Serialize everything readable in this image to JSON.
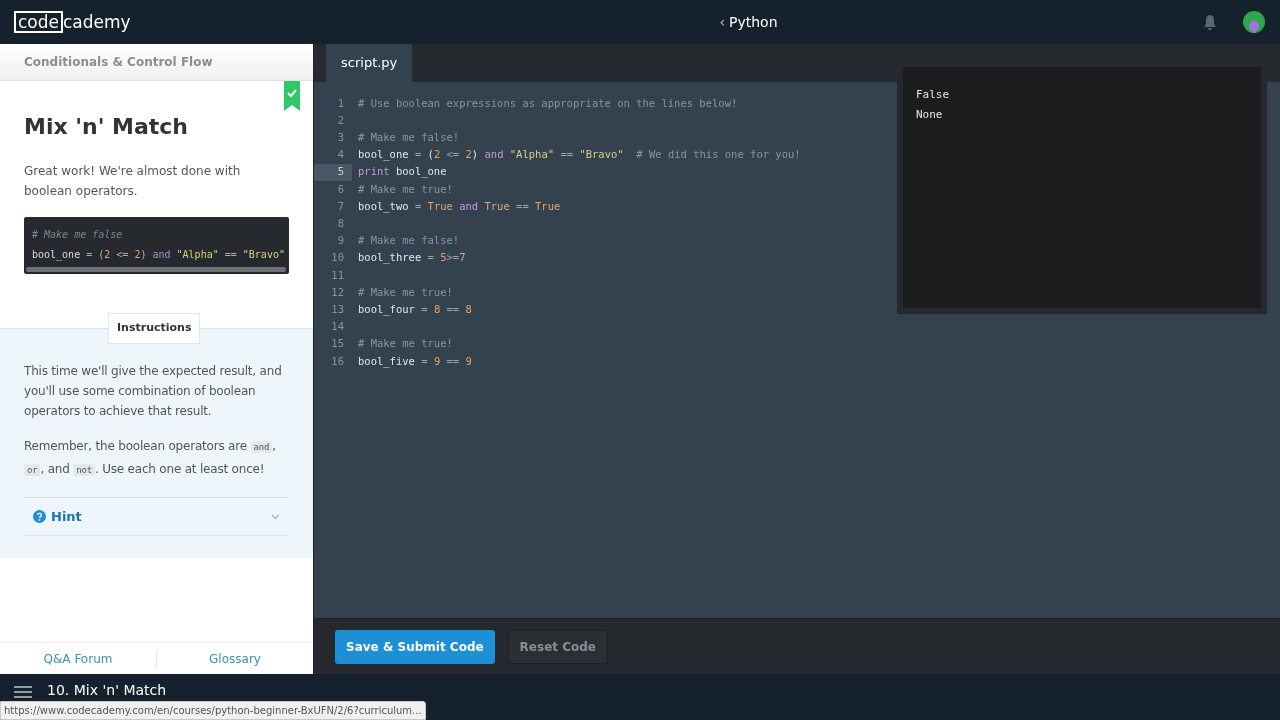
{
  "header": {
    "logo_boxed": "code",
    "logo_rest": "cademy",
    "back": "‹",
    "course": "Python"
  },
  "lesson": {
    "unit": "Conditionals & Control Flow",
    "completed": true,
    "title": "Mix 'n' Match",
    "intro": "Great work! We're almost done with boolean operators.",
    "snippet": [
      [
        {
          "kind": "comment",
          "text": "# Make me false"
        }
      ],
      [
        {
          "kind": "name",
          "text": "bool_one "
        },
        {
          "kind": "op",
          "text": "= ("
        },
        {
          "kind": "num",
          "text": "2"
        },
        {
          "kind": "op",
          "text": " <= "
        },
        {
          "kind": "num",
          "text": "2"
        },
        {
          "kind": "op",
          "text": ") "
        },
        {
          "kind": "kw",
          "text": "and "
        },
        {
          "kind": "str",
          "text": "\"Alpha\""
        },
        {
          "kind": "op",
          "text": " == "
        },
        {
          "kind": "str",
          "text": "\"Bravo\""
        }
      ]
    ],
    "instructions_label": "Instructions",
    "paragraph": "This time we'll give the expected result, and you'll use some combination of boolean operators to achieve that result.",
    "remember": [
      {
        "kind": "text",
        "text": "Remember, the boolean operators are "
      },
      {
        "kind": "code",
        "text": "and"
      },
      {
        "kind": "text",
        "text": ", "
      },
      {
        "kind": "code",
        "text": "or"
      },
      {
        "kind": "text",
        "text": ", and "
      },
      {
        "kind": "code",
        "text": "not"
      },
      {
        "kind": "text",
        "text": ". Use each one at least once!"
      }
    ],
    "hint": {
      "label": "Hint",
      "expanded": false
    },
    "footer": [
      "Q&A Forum",
      "Glossary"
    ]
  },
  "editor": {
    "tab": "script.py",
    "lines": [
      {
        "number": "1",
        "active": false,
        "tokens": [
          {
            "kind": "comment",
            "text": "# Use boolean expressions as appropriate on the lines below!"
          }
        ]
      },
      {
        "number": "2",
        "active": false
      },
      {
        "number": "3",
        "active": false,
        "tokens": [
          {
            "kind": "comment",
            "text": "# Make me false!"
          }
        ]
      },
      {
        "number": "4",
        "active": false,
        "tokens": [
          {
            "kind": "name",
            "text": "bool_one "
          },
          {
            "kind": "op",
            "text": "= "
          },
          {
            "kind": "name",
            "text": "("
          },
          {
            "kind": "num",
            "text": "2"
          },
          {
            "kind": "op",
            "text": " <= "
          },
          {
            "kind": "num",
            "text": "2"
          },
          {
            "kind": "name",
            "text": ") "
          },
          {
            "kind": "kw",
            "text": "and "
          },
          {
            "kind": "str",
            "text": "\"Alpha\""
          },
          {
            "kind": "op",
            "text": " == "
          },
          {
            "kind": "str",
            "text": "\"Bravo\""
          },
          {
            "kind": "comment",
            "text": "  # We did this one for you!"
          }
        ]
      },
      {
        "number": "5",
        "active": true,
        "tokens": [
          {
            "kind": "kw",
            "text": "print "
          },
          {
            "kind": "name",
            "text": "bool_one"
          }
        ]
      },
      {
        "number": "6",
        "active": false,
        "tokens": [
          {
            "kind": "comment",
            "text": "# Make me true!"
          }
        ]
      },
      {
        "number": "7",
        "active": false,
        "tokens": [
          {
            "kind": "name",
            "text": "bool_two "
          },
          {
            "kind": "op",
            "text": "= "
          },
          {
            "kind": "num",
            "text": "True "
          },
          {
            "kind": "kw",
            "text": "and "
          },
          {
            "kind": "num",
            "text": "True "
          },
          {
            "kind": "op",
            "text": "== "
          },
          {
            "kind": "num",
            "text": "True"
          }
        ]
      },
      {
        "number": "8",
        "active": false
      },
      {
        "number": "9",
        "active": false,
        "tokens": [
          {
            "kind": "comment",
            "text": "# Make me false!"
          }
        ]
      },
      {
        "number": "10",
        "active": false,
        "tokens": [
          {
            "kind": "name",
            "text": "bool_three "
          },
          {
            "kind": "op",
            "text": "= "
          },
          {
            "kind": "num",
            "text": "5"
          },
          {
            "kind": "op",
            "text": ">="
          },
          {
            "kind": "num",
            "text": "7"
          }
        ]
      },
      {
        "number": "11",
        "active": false
      },
      {
        "number": "12",
        "active": false,
        "tokens": [
          {
            "kind": "comment",
            "text": "# Make me true!"
          }
        ]
      },
      {
        "number": "13",
        "active": false,
        "tokens": [
          {
            "kind": "name",
            "text": "bool_four "
          },
          {
            "kind": "op",
            "text": "= "
          },
          {
            "kind": "num",
            "text": "8"
          },
          {
            "kind": "op",
            "text": " == "
          },
          {
            "kind": "num",
            "text": "8"
          }
        ]
      },
      {
        "number": "14",
        "active": false
      },
      {
        "number": "15",
        "active": false,
        "tokens": [
          {
            "kind": "comment",
            "text": "# Make me true!"
          }
        ]
      },
      {
        "number": "16",
        "active": false,
        "tokens": [
          {
            "kind": "name",
            "text": "bool_five "
          },
          {
            "kind": "op",
            "text": "= "
          },
          {
            "kind": "num",
            "text": "9"
          },
          {
            "kind": "op",
            "text": " == "
          },
          {
            "kind": "num",
            "text": "9"
          }
        ]
      }
    ]
  },
  "output": [
    "False",
    "None"
  ],
  "buttons": [
    {
      "label": "Save & Submit Code",
      "kind": "primary"
    },
    {
      "label": "Reset Code",
      "kind": "secondary"
    }
  ],
  "bottom_nav": {
    "title": "10. Mix 'n' Match"
  },
  "status_url": "https://www.codecademy.com/en/courses/python-beginner-BxUFN/2/6?curriculum..."
}
